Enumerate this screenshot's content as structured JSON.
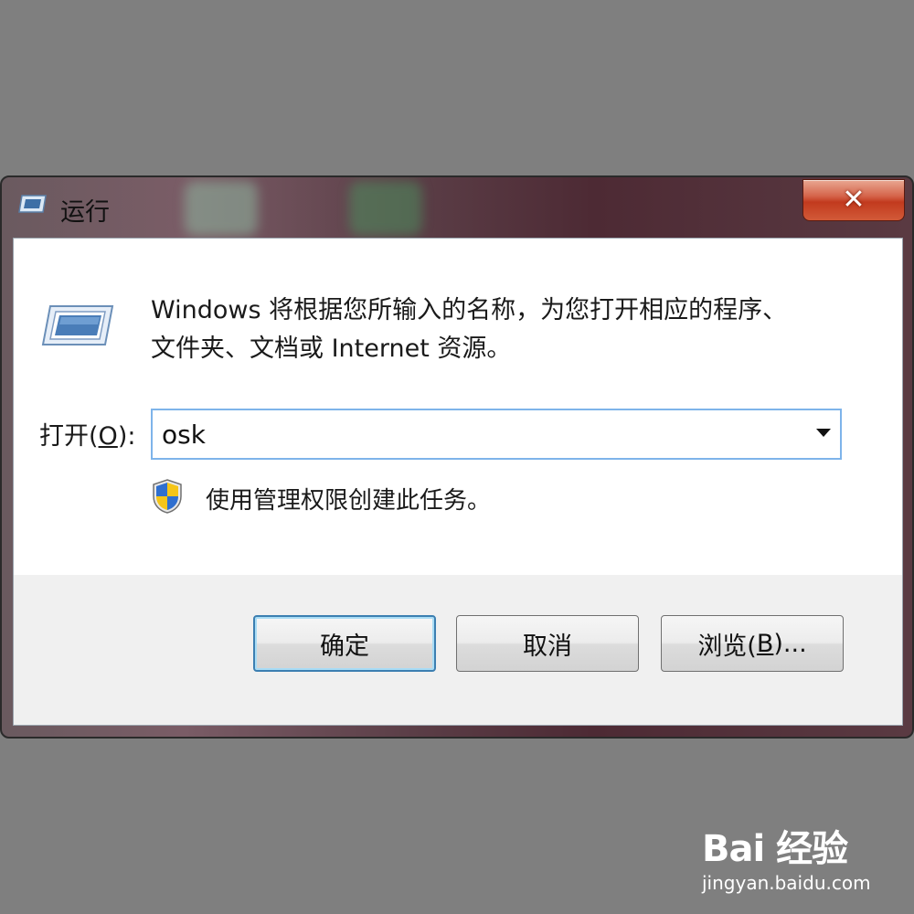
{
  "window": {
    "title": "运行",
    "close_label": "x"
  },
  "content": {
    "description_line1": "Windows 将根据您所输入的名称，为您打开相应的程序、",
    "description_line2": "文件夹、文档或 Internet 资源。",
    "open_label_prefix": "打开(",
    "open_label_key": "O",
    "open_label_suffix": "):",
    "open_value": "osk",
    "admin_text": "使用管理权限创建此任务。"
  },
  "buttons": {
    "ok": "确定",
    "cancel": "取消",
    "browse_prefix": "浏览(",
    "browse_key": "B",
    "browse_suffix": ")..."
  },
  "icons": {
    "title": "run-icon",
    "dialog": "run-icon",
    "uac": "uac-shield-icon",
    "dropdown": "chevron-down-icon"
  },
  "watermark": {
    "logo": "Bai 经验",
    "url": "jingyan.baidu.com"
  },
  "colors": {
    "page_background": "#7f7f7f",
    "focus_border": "#7eb4ea",
    "close_button": "#c23a1e"
  }
}
